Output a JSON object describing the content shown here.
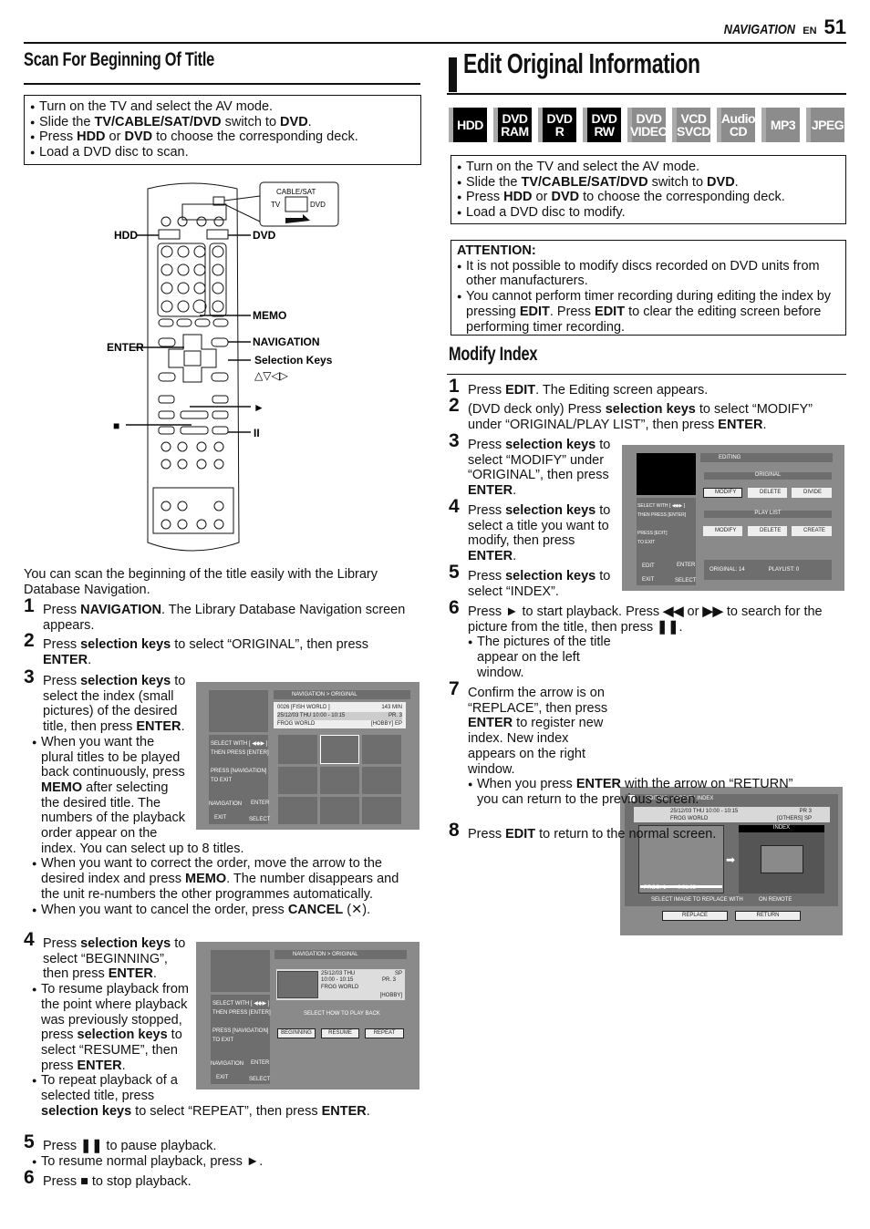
{
  "header": {
    "section": "NAVIGATION",
    "lang": "EN",
    "page": "51"
  },
  "left": {
    "title": "Scan For Beginning Of Title",
    "prep": [
      "Turn on the TV and select the AV mode.",
      [
        "Slide the ",
        "TV/CABLE/SAT/DVD",
        " switch to ",
        "DVD",
        "."
      ],
      [
        "Press ",
        "HDD",
        " or ",
        "DVD",
        " to choose the corresponding deck."
      ],
      "Load a DVD disc to scan."
    ],
    "remote": {
      "hdd": "HDD",
      "dvd": "DVD",
      "memo": "MEMO",
      "navigation": "NAVIGATION",
      "enter": "ENTER",
      "selection_keys": "Selection Keys",
      "arrows": "△▽◁▷",
      "play": "►",
      "stop": "■",
      "pause": "II",
      "switch_title": "CABLE/SAT",
      "switch_tv": "TV",
      "switch_dvd": "DVD"
    },
    "intro": "You can scan the beginning of the title easily with the Library Database Navigation.",
    "steps": [
      {
        "n": "1",
        "text": [
          "Press ",
          "NAVIGATION",
          ". The Library Database Navigation screen appears."
        ]
      },
      {
        "n": "2",
        "text": [
          "Press ",
          "selection keys",
          " to select “ORIGINAL”, then press ",
          "ENTER",
          "."
        ]
      },
      {
        "n": "3",
        "text": [
          "Press ",
          "selection keys",
          " to select the index (small pictures) of the desired title, then press ",
          "ENTER",
          "."
        ],
        "bullets": [
          [
            "When you want the plural titles to be played back continuously, press ",
            "MEMO",
            " after selecting the desired title. The numbers of the playback order appear on the index. You can select up to 8 titles."
          ],
          [
            "When you want to correct the order, move the arrow to the desired index and press ",
            "MEMO",
            ". The number disappears and the unit re-numbers the other programmes automatically."
          ],
          [
            "When you want to cancel the order, press ",
            "CANCEL",
            " (✕)."
          ]
        ]
      },
      {
        "n": "4",
        "text": [
          "Press ",
          "selection keys",
          " to select “BEGINNING”, then press ",
          "ENTER",
          "."
        ],
        "bullets": [
          [
            "To resume playback from the point where playback was previously stopped, press ",
            "selection keys",
            " to select “RESUME”, then press ",
            "ENTER",
            "."
          ],
          [
            "To repeat playback of a selected title, press ",
            "selection keys",
            " to select “REPEAT”, then press ",
            "ENTER",
            "."
          ]
        ]
      },
      {
        "n": "5",
        "text": [
          "Press ",
          "❚❚",
          " to pause playback."
        ],
        "bullets": [
          [
            "To resume normal playback, press ",
            "►",
            "."
          ]
        ]
      },
      {
        "n": "6",
        "text": [
          "Press ",
          "■",
          " to stop playback."
        ]
      }
    ],
    "screen1": {
      "crumb": "NAVIGATION > ORIGINAL",
      "row1": "0026   [FISH WORLD          ]",
      "row1r": "143  MIN",
      "row2": "25/12/03 THU 10:00 - 10:15",
      "row2r": "PR. 3",
      "row3": "FROG WORLD",
      "row3r": "[HOBBY]  EP",
      "help1": "SELECT WITH [ ◀◆▶ ]",
      "help2": "THEN PRESS [ENTER]",
      "help3": "PRESS [NAVIGATION]",
      "help4": "TO EXIT",
      "k_nav": "NAVIGATION",
      "k_enter": "ENTER",
      "k_exit": "EXIT",
      "k_select": "SELECT"
    },
    "screen2": {
      "crumb": "NAVIGATION > ORIGINAL",
      "date": "25/12/03 THU",
      "time": "10:00 - 10:15",
      "sp": "SP",
      "pr": "PR.   3",
      "title": "FROG WORLD",
      "genre": "[HOBBY]",
      "prompt": "SELECT HOW TO PLAY BACK",
      "buttons": [
        "BEGINNING",
        "RESUME",
        "REPEAT"
      ],
      "help1": "SELECT WITH [ ◀◆▶ ]",
      "help2": "THEN PRESS [ENTER]",
      "help3": "PRESS [NAVIGATION]",
      "help4": "TO EXIT",
      "k_nav": "NAVIGATION",
      "k_enter": "ENTER",
      "k_exit": "EXIT",
      "k_select": "SELECT"
    }
  },
  "right": {
    "title": "Edit Original Information",
    "discs": [
      {
        "label": "HDD",
        "active": true
      },
      {
        "label": "DVD RAM",
        "active": true
      },
      {
        "label": "DVD R",
        "active": true
      },
      {
        "label": "DVD RW",
        "active": true
      },
      {
        "label": "DVD VIDEO",
        "active": false
      },
      {
        "label": "VCD SVCD",
        "active": false
      },
      {
        "label": "Audio CD",
        "active": false
      },
      {
        "label": "MP3",
        "active": false
      },
      {
        "label": "JPEG",
        "active": false
      }
    ],
    "prep": [
      "Turn on the TV and select the AV mode.",
      [
        "Slide the ",
        "TV/CABLE/SAT/DVD",
        " switch to ",
        "DVD",
        "."
      ],
      [
        "Press ",
        "HDD",
        " or ",
        "DVD",
        " to choose the corresponding deck."
      ],
      "Load a DVD disc to modify."
    ],
    "attention": {
      "title": "ATTENTION:",
      "items": [
        "It is not possible to modify discs recorded on DVD units from other manufacturers.",
        [
          "You cannot perform timer recording during editing the index by pressing ",
          "EDIT",
          ". Press ",
          "EDIT",
          " to clear the editing screen before performing timer recording."
        ]
      ]
    },
    "subtitle": "Modify Index",
    "steps": [
      {
        "n": "1",
        "text": [
          "Press ",
          "EDIT",
          ". The Editing screen appears."
        ]
      },
      {
        "n": "2",
        "text": [
          "(DVD deck only) Press ",
          "selection keys",
          " to select “MODIFY” under “ORIGINAL/PLAY LIST”, then press ",
          "ENTER",
          "."
        ]
      },
      {
        "n": "3",
        "text": [
          "Press ",
          "selection keys",
          " to select “MODIFY” under “ORIGINAL”, then press ",
          "ENTER",
          "."
        ]
      },
      {
        "n": "4",
        "text": [
          "Press ",
          "selection keys",
          " to select a title you want to modify, then press ",
          "ENTER",
          "."
        ]
      },
      {
        "n": "5",
        "text": [
          "Press ",
          "selection keys",
          " to select “INDEX”."
        ]
      },
      {
        "n": "6",
        "text": [
          "Press ",
          "►",
          " to start playback. Press ",
          "◀◀",
          " or ",
          "▶▶",
          " to search for the picture from the title, then press ",
          "❚❚",
          "."
        ],
        "bullets": [
          "The pictures of the title appear on the left window."
        ]
      },
      {
        "n": "7",
        "text": [
          "Confirm the arrow is on “REPLACE”, then press ",
          "ENTER",
          " to register new index. New index appears on the right window."
        ],
        "bullets": [
          [
            "When you press ",
            "ENTER",
            " with the arrow on “RETURN” you can return to the previous screen."
          ]
        ]
      },
      {
        "n": "8",
        "text": [
          "Press ",
          "EDIT",
          " to return to the normal screen."
        ]
      }
    ],
    "screen3": {
      "crumb": "EDITING",
      "original": "ORIGINAL",
      "playlist": "PLAY LIST",
      "orig_buttons": [
        "MODIFY",
        "DELETE",
        "DIVIDE"
      ],
      "pl_buttons": [
        "MODIFY",
        "DELETE",
        "CREATE"
      ],
      "help1": "SELECT WITH [ ◀◆▶ ]",
      "help2": "THEN PRESS [ENTER]",
      "help3": "PRESS [EDIT]",
      "help4": "TO EXIT",
      "k_edit": "EDIT",
      "k_enter": "ENTER",
      "k_exit": "EXIT",
      "k_select": "SELECT",
      "count_orig": "ORIGINAL: 14",
      "count_pl": "PLAYLIST: 0"
    },
    "screen4": {
      "crumb": "EDITING > MODIFY INDEX",
      "row1": "25/12/03 THU 10:00 - 10:15",
      "row1r": "PR  3",
      "row2": "FROG WORLD",
      "row2r": "[OTHERS]  SP",
      "index": "INDEX",
      "prog": "PROG. 1",
      "time": "0:01:03",
      "hint": "SELECT IMAGE TO REPLACE WITH",
      "hint2": "ON REMOTE",
      "buttons": [
        "REPLACE",
        "RETURN"
      ]
    }
  },
  "colors": {
    "disc_active": "#000000",
    "disc_inactive": "#8c8c8c",
    "screen_bg": "#8a8a8a"
  }
}
